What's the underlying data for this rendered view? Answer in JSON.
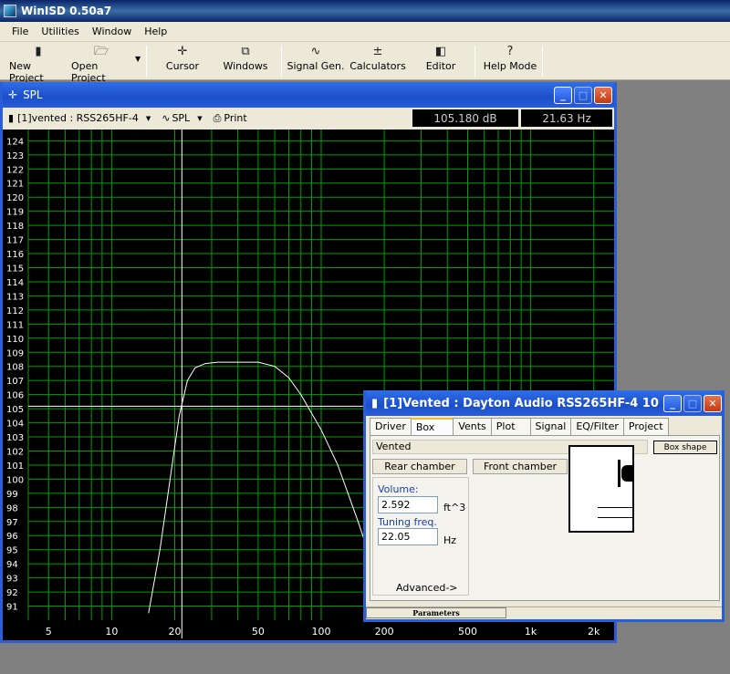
{
  "app": {
    "title": "WinISD 0.50a7"
  },
  "menu": [
    "File",
    "Utilities",
    "Window",
    "Help"
  ],
  "toolbar": {
    "new_project": "New Project",
    "open_project": "Open Project",
    "cursor": "Cursor",
    "windows": "Windows",
    "signal_gen": "Signal Gen.",
    "calculators": "Calculators",
    "editor": "Editor",
    "help_mode": "Help Mode"
  },
  "spl_window": {
    "title": "SPL",
    "project_select": "[1]vented : RSS265HF-4",
    "view_select": "SPL",
    "print": "Print",
    "readout_db": "105.180 dB",
    "readout_hz": "21.63 Hz"
  },
  "chart_data": {
    "type": "line",
    "y_ticks": [
      124,
      123,
      122,
      121,
      120,
      119,
      118,
      117,
      116,
      115,
      114,
      113,
      112,
      111,
      110,
      109,
      108,
      107,
      106,
      105,
      104,
      103,
      102,
      101,
      100,
      99,
      98,
      97,
      96,
      95,
      94,
      93,
      92,
      91
    ],
    "x_ticks": [
      "5",
      "10",
      "20",
      "50",
      "100",
      "200",
      "500",
      "1k",
      "2k"
    ],
    "ylim": [
      90,
      124.8
    ],
    "xlim": [
      4,
      2500
    ],
    "x_scale": "log",
    "grid": true,
    "cursor": {
      "x": 21.63,
      "y": 105.18
    },
    "series": [
      {
        "x": [
          15,
          17,
          19,
          21,
          23,
          25,
          28,
          32,
          40,
          50,
          60,
          70,
          80,
          100,
          120,
          150,
          180,
          200
        ],
        "y": [
          90.5,
          95,
          100,
          104.5,
          107,
          107.9,
          108.2,
          108.3,
          108.3,
          108.3,
          108.0,
          107.2,
          106.0,
          103.5,
          101,
          97,
          93.5,
          91.5
        ]
      }
    ],
    "colors": {
      "grid": "#00a000",
      "curve": "#ffffff",
      "cursor": "#ffffff",
      "labels": "#ffffff"
    }
  },
  "vented_window": {
    "title": "[1]Vented : Dayton Audio RSS265HF-4 10",
    "tabs": [
      "Driver",
      "Box",
      "Vents",
      "Plot",
      "Signal",
      "EQ/Filter",
      "Project"
    ],
    "active_tab": "Box",
    "box_type": "Vented",
    "box_shape_button": "Box shape",
    "rear_chamber_button": "Rear chamber",
    "front_chamber_button": "Front chamber",
    "volume_label": "Volume:",
    "volume_value": "2.592",
    "volume_unit": "ft^3",
    "tuning_label": "Tuning freq.",
    "tuning_value": "22.05",
    "tuning_unit": "Hz",
    "advanced": "Advanced->",
    "status_tab": "Parameters"
  }
}
